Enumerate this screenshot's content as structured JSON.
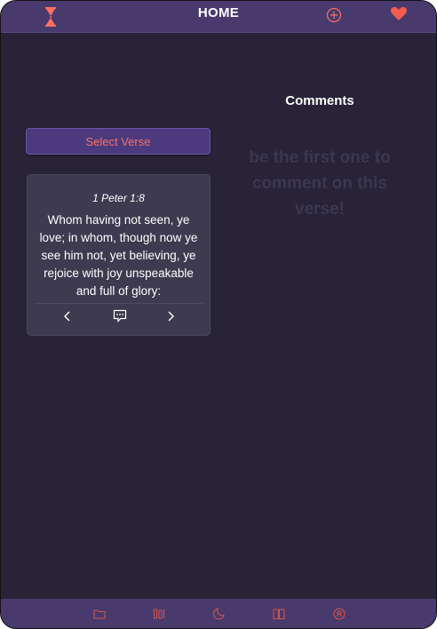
{
  "header": {
    "title": "HOME",
    "icons": [
      "hourglass-icon",
      "plus-circle-icon",
      "heart-icon"
    ]
  },
  "verse": {
    "select_label": "Select Verse",
    "reference": "1 Peter 1:8",
    "text": "Whom having not seen, ye love; in whom, though now ye see him not, yet believing, ye rejoice with joy unspeakable and full of glory:"
  },
  "comments": {
    "title": "Comments",
    "empty_message": "be the first one to comment on this verse!"
  },
  "bottom_nav": {
    "icons": [
      "folder-icon",
      "books-icon",
      "moon-icon",
      "book-icon",
      "registered-icon"
    ]
  },
  "colors": {
    "background": "#282337",
    "bar": "#483a6c",
    "accent": "#ff6f61",
    "card": "#3e3a50"
  }
}
